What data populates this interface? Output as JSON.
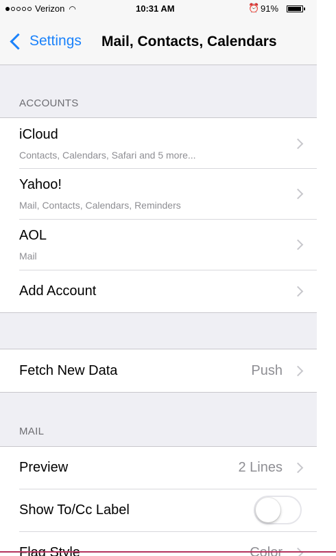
{
  "status_bar": {
    "carrier": "Verizon",
    "time": "10:31 AM",
    "battery_percent": "91%",
    "signal_bars_filled": 1,
    "signal_bars_total": 5,
    "battery_level": 0.91
  },
  "nav": {
    "back_label": "Settings",
    "title": "Mail, Contacts, Calendars"
  },
  "sections": {
    "accounts_header": "ACCOUNTS",
    "mail_header": "MAIL"
  },
  "accounts": [
    {
      "title": "iCloud",
      "subtitle": "Contacts, Calendars, Safari and 5 more..."
    },
    {
      "title": "Yahoo!",
      "subtitle": "Mail, Contacts, Calendars, Reminders"
    },
    {
      "title": "AOL",
      "subtitle": "Mail"
    },
    {
      "title": "Add Account"
    }
  ],
  "fetch": {
    "title": "Fetch New Data",
    "value": "Push"
  },
  "mail": {
    "preview": {
      "title": "Preview",
      "value": "2 Lines"
    },
    "show_tocc": {
      "title": "Show To/Cc Label",
      "enabled": false
    },
    "flag_style": {
      "title": "Flag Style",
      "value": "Color"
    }
  },
  "colors": {
    "tint": "#1a82fb",
    "background": "#efeff4",
    "secondary_text": "#8e8e93"
  },
  "icons": [
    "wifi-icon",
    "alarm-icon",
    "battery-icon",
    "back-chevron-icon",
    "chevron-right-icon"
  ]
}
